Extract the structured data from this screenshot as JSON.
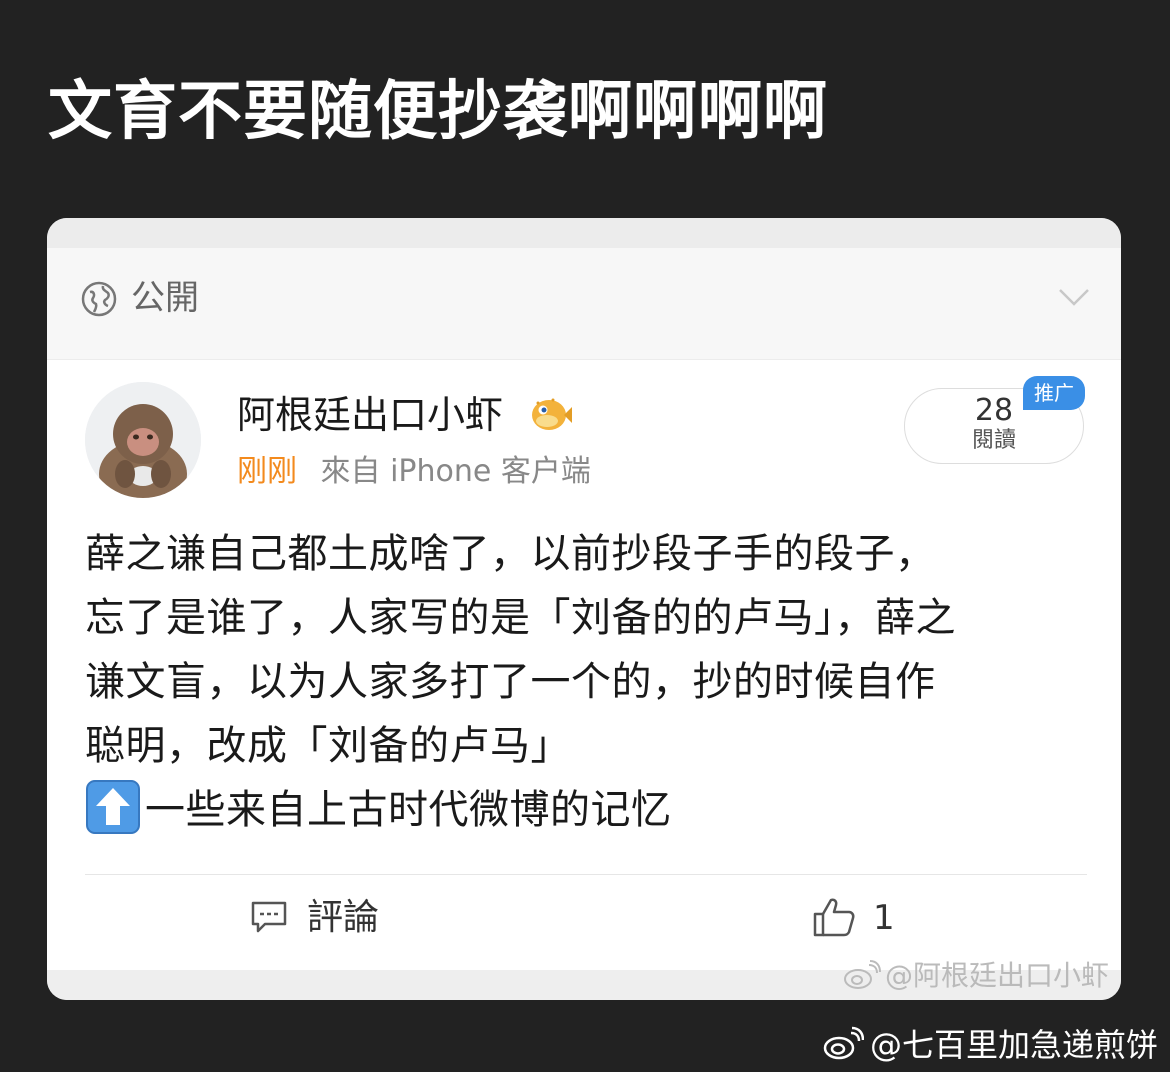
{
  "headline": "文育不要随便抄袭啊啊啊啊",
  "privacy": {
    "label": "公開",
    "icon": "globe-icon",
    "expand_icon": "chevron-down-icon"
  },
  "post": {
    "username": "阿根廷出口小虾",
    "username_badge_icon": "pufferfish-icon",
    "time": "刚刚",
    "source": "來自 iPhone 客户端",
    "views": {
      "count": "28",
      "label": "閱讀",
      "badge": "推广"
    },
    "body_lines": [
      "薛之谦自己都土成啥了，以前抄段子手的段子，",
      "忘了是谁了，人家写的是「刘备的的卢马」，薛之",
      "谦文盲，以为人家多打了一个的，抄的时候自作",
      "聪明，改成「刘备的卢马」",
      "一些来自上古时代微博的记忆"
    ],
    "emoji_icon": "up-arrow-icon",
    "actions": {
      "comment_label": "評論",
      "like_count": "1"
    }
  },
  "watermarks": {
    "inner": "@阿根廷出口小虾",
    "outer": "@七百里加急递煎饼"
  },
  "colors": {
    "page_background": "#222222",
    "time_accent": "#f38a1d",
    "promo_badge": "#3a8fe6"
  }
}
